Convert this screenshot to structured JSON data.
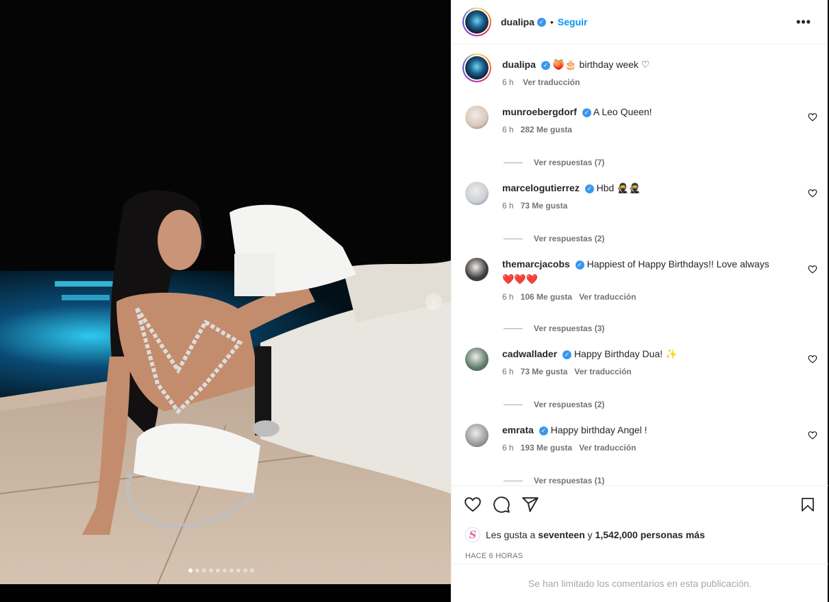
{
  "post": {
    "username": "dualipa",
    "follow_label": "Seguir",
    "separator": "•",
    "more_label": "•••",
    "caption_text": "🍑🎂 birthday week ♡",
    "caption_time": "6 h",
    "caption_translate": "Ver traducción"
  },
  "comments": [
    {
      "user": "munroebergdorf",
      "text": "A Leo Queen!",
      "time": "6 h",
      "likes": "282 Me gusta",
      "translate": "",
      "replies": "Ver respuestas (7)",
      "avatar_color": "#d9c6b8"
    },
    {
      "user": "marcelogutierrez",
      "text": "Hbd",
      "emoji": "🥷🥷",
      "time": "6 h",
      "likes": "73 Me gusta",
      "translate": "",
      "replies": "Ver respuestas (2)",
      "avatar_color": "#c9ced6"
    },
    {
      "user": "themarcjacobs",
      "text": "Happiest of Happy Birthdays!! Love always",
      "hearts": "❤️❤️❤️",
      "time": "6 h",
      "likes": "106 Me gusta",
      "translate": "Ver traducción",
      "replies": "Ver respuestas (3)",
      "avatar_color": "#3a3a3a"
    },
    {
      "user": "cadwallader",
      "text": "Happy Birthday Dua!",
      "emoji": "✨",
      "time": "6 h",
      "likes": "73 Me gusta",
      "translate": "Ver traducción",
      "replies": "Ver respuestas (2)",
      "avatar_color": "#5c7a66"
    },
    {
      "user": "emrata",
      "text": "Happy birthday Angel !",
      "time": "6 h",
      "likes": "193 Me gusta",
      "translate": "Ver traducción",
      "replies": "Ver respuestas (1)",
      "avatar_color": "#9a9a9a"
    }
  ],
  "likes": {
    "prefix": "Les gusta a",
    "user": "seventeen",
    "connector": "y",
    "count": "1,542,000 personas más",
    "badge_letter": "S"
  },
  "timestamp": "HACE 6 HORAS",
  "comments_limited": "Se han limitado los comentarios en esta publicación.",
  "carousel": {
    "total": 10,
    "active_index": 0
  },
  "colors": {
    "accent": "#0095f6",
    "verified": "#3897f0",
    "muted": "#737373"
  }
}
